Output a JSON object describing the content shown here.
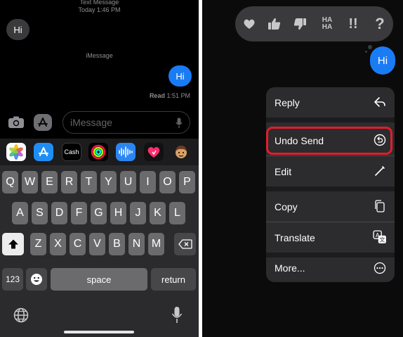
{
  "left": {
    "header": {
      "line1": "Text Message",
      "line2": "Today 1:46 PM"
    },
    "incoming_message": "Hi",
    "service_label": "iMessage",
    "outgoing_message": "Hi",
    "read_receipt": {
      "label": "Read",
      "time": "1:51 PM"
    },
    "compose": {
      "placeholder": "iMessage"
    },
    "app_bar": [
      {
        "icon": "photos-icon"
      },
      {
        "icon": "app-store-icon"
      },
      {
        "icon": "apple-cash-icon",
        "label": "Cash"
      },
      {
        "icon": "fitness-icon"
      },
      {
        "icon": "audio-message-icon"
      },
      {
        "icon": "digital-touch-icon"
      },
      {
        "icon": "memoji-icon"
      }
    ],
    "keyboard": {
      "row1": [
        "Q",
        "W",
        "E",
        "R",
        "T",
        "Y",
        "U",
        "I",
        "O",
        "P"
      ],
      "row2": [
        "A",
        "S",
        "D",
        "F",
        "G",
        "H",
        "J",
        "K",
        "L"
      ],
      "row3": [
        "Z",
        "X",
        "C",
        "V",
        "B",
        "N",
        "M"
      ],
      "numbers_key": "123",
      "space_key": "space",
      "return_key": "return"
    }
  },
  "right": {
    "reactions": [
      "heart-icon",
      "thumbs-up-icon",
      "thumbs-down-icon",
      "haha-icon",
      "exclamation-icon",
      "question-icon"
    ],
    "reaction_text": {
      "haha": "HA HA",
      "exclaim": "!!",
      "question": "?"
    },
    "message": "Hi",
    "menu": [
      {
        "label": "Reply",
        "icon": "reply-icon"
      },
      {
        "label": "Undo Send",
        "icon": "undo-send-icon",
        "highlighted": true
      },
      {
        "label": "Edit",
        "icon": "edit-pencil-icon"
      },
      {
        "label": "Copy",
        "icon": "copy-icon"
      },
      {
        "label": "Translate",
        "icon": "translate-icon"
      },
      {
        "label": "More...",
        "icon": "more-ellipsis-icon"
      }
    ],
    "highlight_color": "#e11d2b"
  },
  "colors": {
    "imessage_blue": "#1a7cf5",
    "incoming_gray": "#3a3a3c",
    "menu_bg": "#2c2c2e",
    "key_gray": "#6b6b6e"
  }
}
